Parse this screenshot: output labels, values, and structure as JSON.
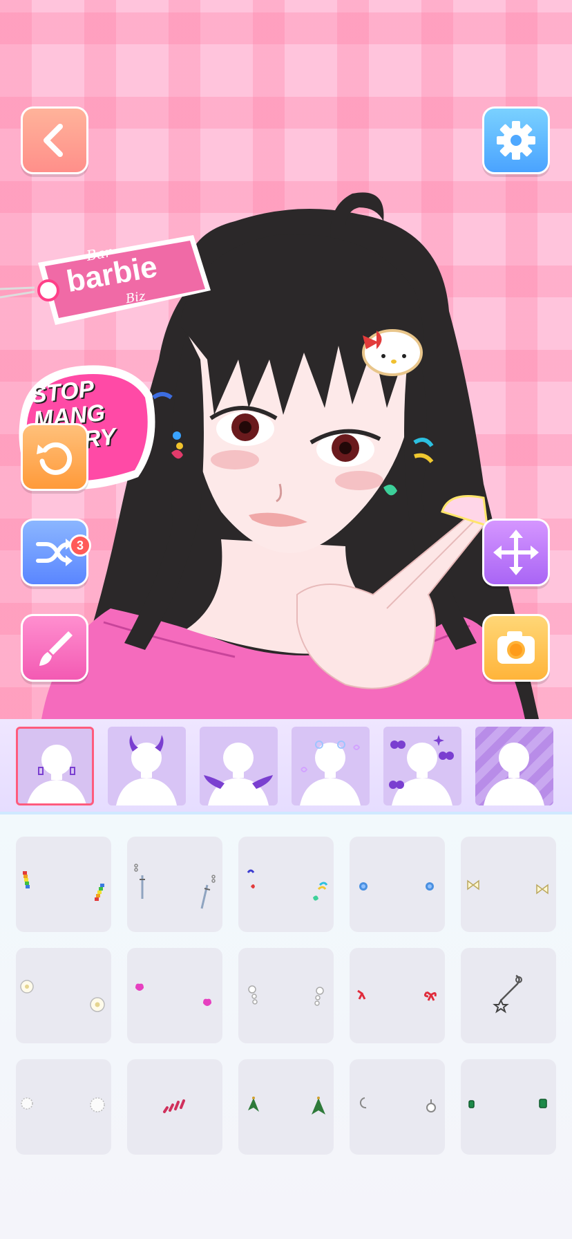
{
  "stage": {
    "sticker_tag_small_top": "Bar",
    "sticker_tag_main": "barbie",
    "sticker_tag_small_bottom": "Biz",
    "sticker_graffiti": "STOP MANG STORY"
  },
  "toolbar": {
    "back_icon": "chevron-left-icon",
    "settings_icon": "gear-icon",
    "undo_icon": "undo-icon",
    "shuffle_icon": "shuffle-icon",
    "shuffle_badge": "3",
    "brush_icon": "brush-icon",
    "move_icon": "move-arrows-icon",
    "camera_icon": "camera-icon"
  },
  "tabs": [
    {
      "id": "earrings",
      "selected": true
    },
    {
      "id": "horns",
      "selected": false
    },
    {
      "id": "wings",
      "selected": false
    },
    {
      "id": "doodles",
      "selected": false
    },
    {
      "id": "cherries",
      "selected": false
    },
    {
      "id": "background",
      "selected": false
    }
  ],
  "items": [
    {
      "id": "rainbow-bead-earrings"
    },
    {
      "id": "sword-dangle-earrings"
    },
    {
      "id": "heart-charm-earrings"
    },
    {
      "id": "blue-stud-earrings"
    },
    {
      "id": "bow-earrings"
    },
    {
      "id": "white-flower-earrings"
    },
    {
      "id": "pink-heart-earrings"
    },
    {
      "id": "pearl-drop-earrings"
    },
    {
      "id": "red-ribbon-earrings"
    },
    {
      "id": "star-chain-ear-cuff"
    },
    {
      "id": "fluffy-ball-earrings"
    },
    {
      "id": "red-ear-cuffs"
    },
    {
      "id": "green-leaf-earrings"
    },
    {
      "id": "moon-hoop-earrings"
    },
    {
      "id": "emerald-stud-earrings"
    }
  ],
  "colors": {
    "stage_bg": "#ffc4dc",
    "tab_selected_border": "#ff5b7d",
    "tab_bg": "#d8c4f5",
    "accent_purple": "#7a3fd0"
  }
}
